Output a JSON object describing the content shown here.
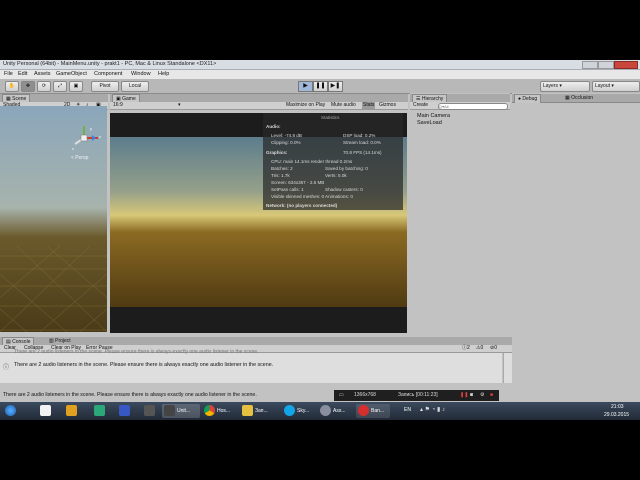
{
  "window": {
    "title": "Unity Personal (64bit) - MainMenu.unity - prakt1 - PC, Mac & Linux Standalone <DX11>"
  },
  "menu": [
    "File",
    "Edit",
    "Assets",
    "GameObject",
    "Component",
    "Window",
    "Help"
  ],
  "toolbar": {
    "pivot": "Pivot",
    "local": "Local",
    "layers": "Layers",
    "layout": "Layout"
  },
  "scene": {
    "tab": "Scene",
    "shading": "Shaded",
    "mode_2d": "2D",
    "gizmo_label": "< Persp",
    "axis_y": "y",
    "axis_x": "x",
    "axis_z": "z"
  },
  "game": {
    "tab": "Game",
    "aspect": "16:9",
    "maximize": "Maximize on Play",
    "mute": "Mute audio",
    "stats": "Stats",
    "gizmos": "Gizmos"
  },
  "stats": {
    "title": "Statistics",
    "audio_header": "Audio:",
    "level": "Level: -74.8 dB",
    "dsp": "DSP load: 0.2%",
    "clipping": "Clipping: 0.0%",
    "stream": "Stream load: 0.0%",
    "graphics_header": "Graphics:",
    "fps": "70.8 FPS (14.1ms)",
    "cpu": "CPU: main 14.1ms   render thread 0.2ms",
    "batches": "Batches: 2",
    "saved": "Saved by batching: 0",
    "tris": "Tris: 1.7k",
    "verts": "Verts: 5.0k",
    "screen": "Screen: 634x357 - 2.6 MB",
    "setpass": "SetPass calls: 1",
    "shadow": "Shadow casters: 0",
    "skinned": "Visible skinned meshes: 0   Animations: 0",
    "network": "Network: (no players connected)"
  },
  "hierarchy": {
    "tab": "Hierarchy",
    "create": "Create",
    "search_placeholder": "Q▾All",
    "items": [
      "Main Camera",
      "SaveLoad"
    ]
  },
  "inspector": {
    "tab_debug": "Debug",
    "tab_occlusion": "Occlusion"
  },
  "console": {
    "tab_console": "Console",
    "tab_project": "Project",
    "clear": "Clear",
    "collapse": "Collapse",
    "clear_on_play": "Clear on Play",
    "error_pause": "Error Pause",
    "count_info": "2",
    "count_warn": "0",
    "count_err": "0",
    "log_cut": "There are 2 audio listeners in the scene. Please ensure there is always exactly one audio listener in the scene.",
    "log": "There are 2 audio listeners in the scene. Please ensure there is always exactly one audio listener in the scene.",
    "status": "There are 2 audio listeners in the scene. Please ensure there is always exactly one audio listener in the scene."
  },
  "recording": {
    "resolution": "1366x768",
    "label": "Запись [00:11:23]"
  },
  "taskbar": {
    "items": [
      "Unit...",
      "Hos...",
      "Зап...",
      "Sky...",
      "Ass...",
      "Ban..."
    ],
    "lang": "EN",
    "time": "21:03",
    "date": "29.03.2015"
  },
  "colors": {
    "accent_blue": "#3d7fe0",
    "play_bg": "#e6e6e6"
  }
}
